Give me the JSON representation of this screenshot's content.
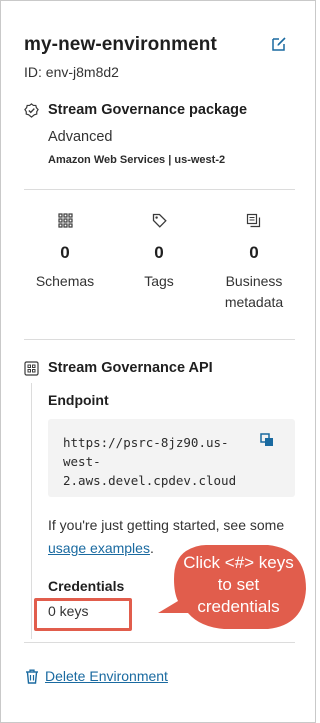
{
  "environment": {
    "name": "my-new-environment",
    "id_text": "ID: env-j8m8d2"
  },
  "package": {
    "title": "Stream Governance package",
    "level": "Advanced",
    "cloud_region": "Amazon Web Services | us-west-2"
  },
  "stats": [
    {
      "icon": "schemas-grid-icon",
      "value": "0",
      "label": "Schemas"
    },
    {
      "icon": "tag-icon",
      "value": "0",
      "label": "Tags"
    },
    {
      "icon": "business-metadata-icon",
      "value": "0",
      "label": "Business metadata"
    }
  ],
  "api": {
    "title": "Stream Governance API",
    "endpoint_label": "Endpoint",
    "endpoint_url": "https://psrc-8jz90.us-\nwest-\n2.aws.devel.cpdev.cloud",
    "help_prefix": "If you're just getting started, see some ",
    "help_link": "usage examples",
    "help_suffix": ".",
    "credentials_label": "Credentials",
    "keys_count": "0 keys"
  },
  "annotation": {
    "callout_text": "Click <#> keys to set credentials"
  },
  "actions": {
    "delete_label": "Delete Environment"
  },
  "colors": {
    "link": "#1a6aa0",
    "callout": "#e15d4c",
    "code_bg": "#f3f3f3"
  }
}
